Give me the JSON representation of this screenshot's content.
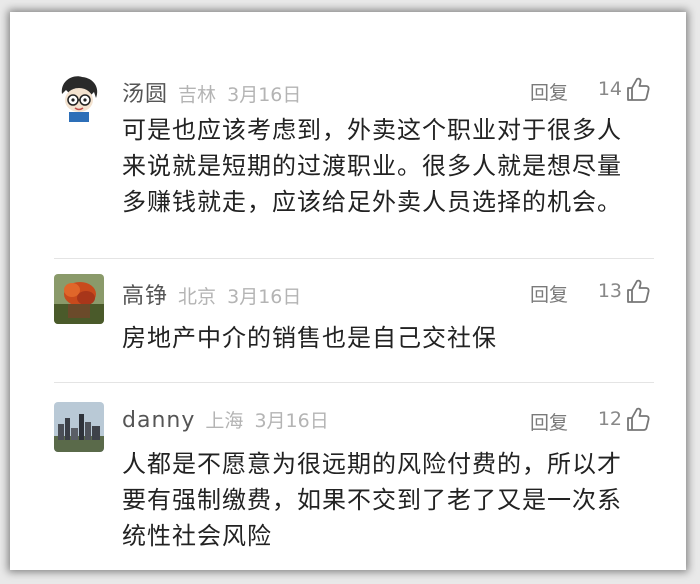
{
  "comments": [
    {
      "user": "汤圆",
      "location": "吉林",
      "date": "3月16日",
      "reply_label": "回复",
      "likes": "14",
      "text": "可是也应该考虑到，外卖这个职业对于很多人\n来说就是短期的过渡职业。很多人就是想尽量\n多赚钱就走，应该给足外卖人员选择的机会。"
    },
    {
      "user": "高铮",
      "location": "北京",
      "date": "3月16日",
      "reply_label": "回复",
      "likes": "13",
      "text": "房地产中介的销售也是自己交社保"
    },
    {
      "user": "danny",
      "location": "上海",
      "date": "3月16日",
      "reply_label": "回复",
      "likes": "12",
      "text": "人都是不愿意为很远期的风险付费的，所以才\n要有强制缴费，如果不交到了老了又是一次系\n统性社会风险"
    }
  ],
  "icons": {
    "like": "thumbs-up-icon",
    "avatar_1": "cartoon-avatar",
    "avatar_2": "flower-photo-avatar",
    "avatar_3": "city-skyline-avatar"
  }
}
